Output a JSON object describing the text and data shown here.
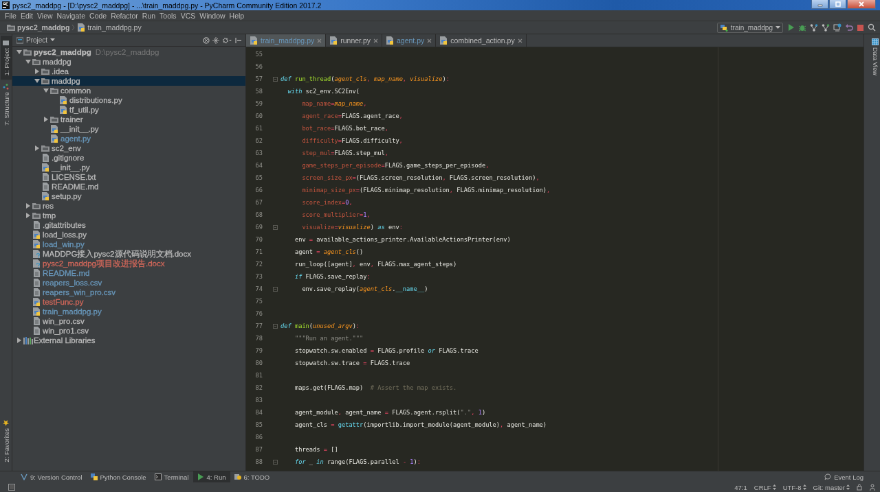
{
  "window": {
    "title": "pysc2_maddpg - [D:\\pysc2_maddpg] - ...\\train_maddpg.py - PyCharm Community Edition 2017.2"
  },
  "menu": [
    "File",
    "Edit",
    "View",
    "Navigate",
    "Code",
    "Refactor",
    "Run",
    "Tools",
    "VCS",
    "Window",
    "Help"
  ],
  "breadcrumbs": [
    {
      "label": "pysc2_maddpg",
      "kind": "folder"
    },
    {
      "label": "train_maddpg.py",
      "kind": "python"
    }
  ],
  "run_config": {
    "label": "train_maddpg"
  },
  "left_tool_tabs": [
    {
      "label": "1: Project",
      "selected": true
    },
    {
      "label": "7: Structure",
      "selected": false
    }
  ],
  "favorites_tab": {
    "label": "2: Favorites"
  },
  "project_panel": {
    "title": "Project",
    "tree": [
      {
        "label": "pysc2_maddpg",
        "hint": "D:\\pysc2_maddpg",
        "kind": "folder",
        "expanded": true,
        "selected": false,
        "color": "#bbbbbb",
        "children": [
          {
            "label": "maddpg",
            "kind": "folder",
            "expanded": true,
            "selected": false,
            "color": "#bbbbbb",
            "children": [
              {
                "label": ".idea",
                "kind": "folder",
                "expanded": false,
                "selected": false,
                "color": "#bbbbbb"
              },
              {
                "label": "maddpg",
                "kind": "folder",
                "expanded": true,
                "selected": true,
                "children": [
                  {
                    "label": "common",
                    "kind": "folder",
                    "expanded": true,
                    "selected": false,
                    "color": "#bbbbbb",
                    "children": [
                      {
                        "label": "distributions.py",
                        "kind": "python",
                        "selected": false,
                        "color": "#bbbbbb"
                      },
                      {
                        "label": "tf_util.py",
                        "kind": "python",
                        "selected": false,
                        "color": "#bbbbbb"
                      }
                    ]
                  },
                  {
                    "label": "trainer",
                    "kind": "folder",
                    "expanded": false,
                    "selected": false,
                    "color": "#bbbbbb"
                  },
                  {
                    "label": "__init__.py",
                    "kind": "python",
                    "selected": false,
                    "color": "#bbbbbb"
                  },
                  {
                    "label": "agent.py",
                    "kind": "python",
                    "selected": false,
                    "color": "#6897bb"
                  }
                ]
              },
              {
                "label": "sc2_env",
                "kind": "folder",
                "expanded": false,
                "selected": false,
                "color": "#bbbbbb"
              },
              {
                "label": ".gitignore",
                "kind": "text",
                "selected": false,
                "color": "#bbbbbb"
              },
              {
                "label": "__init__.py",
                "kind": "python",
                "selected": false,
                "color": "#bbbbbb"
              },
              {
                "label": "LICENSE.txt",
                "kind": "text",
                "selected": false,
                "color": "#bbbbbb"
              },
              {
                "label": "README.md",
                "kind": "text",
                "selected": false,
                "color": "#bbbbbb"
              },
              {
                "label": "setup.py",
                "kind": "python",
                "selected": false,
                "color": "#bbbbbb"
              }
            ]
          },
          {
            "label": "res",
            "kind": "folder",
            "expanded": false,
            "selected": false,
            "color": "#bbbbbb"
          },
          {
            "label": "tmp",
            "kind": "folder",
            "expanded": false,
            "selected": false,
            "color": "#bbbbbb"
          },
          {
            "label": ".gitattributes",
            "kind": "text",
            "selected": false,
            "color": "#bbbbbb"
          },
          {
            "label": "load_loss.py",
            "kind": "python",
            "selected": false,
            "color": "#bbbbbb"
          },
          {
            "label": "load_win.py",
            "kind": "python",
            "selected": false,
            "color": "#6897bb"
          },
          {
            "label": "MADDPG接入pysc2源代码说明文档.docx",
            "kind": "unknown",
            "selected": false,
            "color": "#bbbbbb"
          },
          {
            "label": "pysc2_maddpg项目改进报告.docx",
            "kind": "unknown",
            "selected": false,
            "color": "#d1675a"
          },
          {
            "label": "README.md",
            "kind": "text",
            "selected": false,
            "color": "#6897bb"
          },
          {
            "label": "reapers_loss.csv",
            "kind": "text",
            "selected": false,
            "color": "#6897bb"
          },
          {
            "label": "reapers_win_pro.csv",
            "kind": "text",
            "selected": false,
            "color": "#6897bb"
          },
          {
            "label": "testFunc.py",
            "kind": "python",
            "selected": false,
            "color": "#d1675a"
          },
          {
            "label": "train_maddpg.py",
            "kind": "python",
            "selected": false,
            "color": "#6897bb"
          },
          {
            "label": "win_pro.csv",
            "kind": "text",
            "selected": false,
            "color": "#bbbbbb"
          },
          {
            "label": "win_pro1.csv",
            "kind": "text",
            "selected": false,
            "color": "#bbbbbb"
          }
        ]
      },
      {
        "label": "External Libraries",
        "kind": "library",
        "expanded": false,
        "selected": false,
        "color": "#bbbbbb"
      }
    ]
  },
  "editor": {
    "tabs": [
      {
        "label": "train_maddpg.py",
        "selected": true,
        "color": "#6897bb"
      },
      {
        "label": "runner.py",
        "selected": false,
        "color": "#bbbbbb"
      },
      {
        "label": "agent.py",
        "selected": false,
        "color": "#6897bb"
      },
      {
        "label": "combined_action.py",
        "selected": false,
        "color": "#bbbbbb"
      }
    ],
    "lines": [
      {
        "number": "55"
      },
      {
        "number": "56"
      },
      {
        "number": "57",
        "fold": true,
        "tokens": [
          {
            "kind": "keyword",
            "text": "def "
          },
          {
            "kind": "function",
            "text": "run_thread"
          },
          {
            "kind": "plain",
            "text": "("
          },
          {
            "kind": "param",
            "text": "agent_cls"
          },
          {
            "kind": "operator",
            "text": ", "
          },
          {
            "kind": "param",
            "text": "map_name"
          },
          {
            "kind": "operator",
            "text": ", "
          },
          {
            "kind": "param",
            "text": "visualize"
          },
          {
            "kind": "plain",
            "text": ")"
          },
          {
            "kind": "operator",
            "text": ":"
          }
        ]
      },
      {
        "number": "58",
        "tokens": [
          {
            "kind": "keyword",
            "text": "  with"
          },
          {
            "kind": "plain",
            "text": " sc2_env.SC2Env("
          }
        ]
      },
      {
        "number": "59",
        "tokens": [
          {
            "kind": "kwarg",
            "text": "      map_name"
          },
          {
            "kind": "operator",
            "text": "="
          },
          {
            "kind": "param",
            "text": "map_name"
          },
          {
            "kind": "operator",
            "text": ","
          }
        ]
      },
      {
        "number": "60",
        "tokens": [
          {
            "kind": "kwarg",
            "text": "      agent_race"
          },
          {
            "kind": "operator",
            "text": "="
          },
          {
            "kind": "plain",
            "text": "FLAGS.agent_race"
          },
          {
            "kind": "operator",
            "text": ","
          }
        ]
      },
      {
        "number": "61",
        "tokens": [
          {
            "kind": "kwarg",
            "text": "      bot_race"
          },
          {
            "kind": "operator",
            "text": "="
          },
          {
            "kind": "plain",
            "text": "FLAGS.bot_race"
          },
          {
            "kind": "operator",
            "text": ","
          }
        ]
      },
      {
        "number": "62",
        "tokens": [
          {
            "kind": "kwarg",
            "text": "      difficulty"
          },
          {
            "kind": "operator",
            "text": "="
          },
          {
            "kind": "plain",
            "text": "FLAGS.difficulty"
          },
          {
            "kind": "operator",
            "text": ","
          }
        ]
      },
      {
        "number": "63",
        "tokens": [
          {
            "kind": "kwarg",
            "text": "      step_mul"
          },
          {
            "kind": "operator",
            "text": "="
          },
          {
            "kind": "plain",
            "text": "FLAGS.step_mul"
          },
          {
            "kind": "operator",
            "text": ","
          }
        ]
      },
      {
        "number": "64",
        "tokens": [
          {
            "kind": "kwarg",
            "text": "      game_steps_per_episode"
          },
          {
            "kind": "operator",
            "text": "="
          },
          {
            "kind": "plain",
            "text": "FLAGS.game_steps_per_episode"
          },
          {
            "kind": "operator",
            "text": ","
          }
        ]
      },
      {
        "number": "65",
        "tokens": [
          {
            "kind": "kwarg",
            "text": "      screen_size_px"
          },
          {
            "kind": "operator",
            "text": "="
          },
          {
            "kind": "plain",
            "text": "(FLAGS.screen_resolution"
          },
          {
            "kind": "operator",
            "text": ", "
          },
          {
            "kind": "plain",
            "text": "FLAGS.screen_resolution)"
          },
          {
            "kind": "operator",
            "text": ","
          }
        ]
      },
      {
        "number": "66",
        "tokens": [
          {
            "kind": "kwarg",
            "text": "      minimap_size_px"
          },
          {
            "kind": "operator",
            "text": "="
          },
          {
            "kind": "plain",
            "text": "(FLAGS.minimap_resolution"
          },
          {
            "kind": "operator",
            "text": ", "
          },
          {
            "kind": "plain",
            "text": "FLAGS.minimap_resolution)"
          },
          {
            "kind": "operator",
            "text": ","
          }
        ]
      },
      {
        "number": "67",
        "tokens": [
          {
            "kind": "kwarg",
            "text": "      score_index"
          },
          {
            "kind": "operator",
            "text": "="
          },
          {
            "kind": "number",
            "text": "0"
          },
          {
            "kind": "operator",
            "text": ","
          }
        ]
      },
      {
        "number": "68",
        "tokens": [
          {
            "kind": "kwarg",
            "text": "      score_multiplier"
          },
          {
            "kind": "operator",
            "text": "="
          },
          {
            "kind": "number",
            "text": "1"
          },
          {
            "kind": "operator",
            "text": ","
          }
        ]
      },
      {
        "number": "69",
        "fold": true,
        "tokens": [
          {
            "kind": "kwarg",
            "text": "      visualize"
          },
          {
            "kind": "operator",
            "text": "="
          },
          {
            "kind": "param",
            "text": "visualize"
          },
          {
            "kind": "plain",
            "text": ") "
          },
          {
            "kind": "keyword",
            "text": "as"
          },
          {
            "kind": "plain",
            "text": " env"
          },
          {
            "kind": "operator",
            "text": ":"
          }
        ]
      },
      {
        "number": "70",
        "tokens": [
          {
            "kind": "plain",
            "text": "    env "
          },
          {
            "kind": "operator",
            "text": "="
          },
          {
            "kind": "plain",
            "text": " available_actions_printer.AvailableActionsPrinter(env)"
          }
        ]
      },
      {
        "number": "71",
        "tokens": [
          {
            "kind": "plain",
            "text": "    agent "
          },
          {
            "kind": "operator",
            "text": "="
          },
          {
            "kind": "param",
            "text": " agent_cls"
          },
          {
            "kind": "plain",
            "text": "()"
          }
        ]
      },
      {
        "number": "72",
        "tokens": [
          {
            "kind": "plain",
            "text": "    run_loop([agent]"
          },
          {
            "kind": "operator",
            "text": ", "
          },
          {
            "kind": "plain",
            "text": "env"
          },
          {
            "kind": "operator",
            "text": ", "
          },
          {
            "kind": "plain",
            "text": "FLAGS.max_agent_steps)"
          }
        ]
      },
      {
        "number": "73",
        "tokens": [
          {
            "kind": "keyword",
            "text": "    if"
          },
          {
            "kind": "plain",
            "text": " FLAGS.save_replay"
          },
          {
            "kind": "operator",
            "text": ":"
          }
        ]
      },
      {
        "number": "74",
        "fold": true,
        "tokens": [
          {
            "kind": "plain",
            "text": "      env.save_replay("
          },
          {
            "kind": "param",
            "text": "agent_cls"
          },
          {
            "kind": "plain",
            "text": "."
          },
          {
            "kind": "builtin",
            "text": "__name__"
          },
          {
            "kind": "plain",
            "text": ")"
          }
        ]
      },
      {
        "number": "75"
      },
      {
        "number": "76"
      },
      {
        "number": "77",
        "fold": true,
        "tokens": [
          {
            "kind": "keyword",
            "text": "def "
          },
          {
            "kind": "function",
            "text": "main"
          },
          {
            "kind": "plain",
            "text": "("
          },
          {
            "kind": "param",
            "text": "unused_argv"
          },
          {
            "kind": "plain",
            "text": ")"
          },
          {
            "kind": "operator",
            "text": ":"
          }
        ]
      },
      {
        "number": "78",
        "tokens": [
          {
            "kind": "string",
            "text": "    \"\"\"Run an agent.\"\"\""
          }
        ]
      },
      {
        "number": "79",
        "tokens": [
          {
            "kind": "plain",
            "text": "    stopwatch.sw.enabled "
          },
          {
            "kind": "operator",
            "text": "="
          },
          {
            "kind": "plain",
            "text": " FLAGS.profile "
          },
          {
            "kind": "keyword",
            "text": "or"
          },
          {
            "kind": "plain",
            "text": " FLAGS.trace"
          }
        ]
      },
      {
        "number": "80",
        "tokens": [
          {
            "kind": "plain",
            "text": "    stopwatch.sw.trace "
          },
          {
            "kind": "operator",
            "text": "="
          },
          {
            "kind": "plain",
            "text": " FLAGS.trace"
          }
        ]
      },
      {
        "number": "81"
      },
      {
        "number": "82",
        "tokens": [
          {
            "kind": "plain",
            "text": "    maps.get(FLAGS.map)  "
          },
          {
            "kind": "comment",
            "text": "# Assert the map exists."
          }
        ]
      },
      {
        "number": "83"
      },
      {
        "number": "84",
        "tokens": [
          {
            "kind": "plain",
            "text": "    agent_module"
          },
          {
            "kind": "operator",
            "text": ", "
          },
          {
            "kind": "plain",
            "text": "agent_name "
          },
          {
            "kind": "operator",
            "text": "="
          },
          {
            "kind": "plain",
            "text": " FLAGS.agent.rsplit("
          },
          {
            "kind": "string",
            "text": "\".\""
          },
          {
            "kind": "operator",
            "text": ", "
          },
          {
            "kind": "number",
            "text": "1"
          },
          {
            "kind": "plain",
            "text": ")"
          }
        ]
      },
      {
        "number": "85",
        "tokens": [
          {
            "kind": "plain",
            "text": "    agent_cls "
          },
          {
            "kind": "operator",
            "text": "="
          },
          {
            "kind": "builtin",
            "text": " getattr"
          },
          {
            "kind": "plain",
            "text": "(importlib.import_module(agent_module)"
          },
          {
            "kind": "operator",
            "text": ", "
          },
          {
            "kind": "plain",
            "text": "agent_name)"
          }
        ]
      },
      {
        "number": "86"
      },
      {
        "number": "87",
        "tokens": [
          {
            "kind": "plain",
            "text": "    threads "
          },
          {
            "kind": "operator",
            "text": "="
          },
          {
            "kind": "plain",
            "text": " []"
          }
        ]
      },
      {
        "number": "88",
        "fold": true,
        "tokens": [
          {
            "kind": "keyword",
            "text": "    for"
          },
          {
            "kind": "plain",
            "text": " _ "
          },
          {
            "kind": "keyword",
            "text": "in"
          },
          {
            "kind": "plain",
            "text": " range(FLAGS.parallel "
          },
          {
            "kind": "operator",
            "text": "-"
          },
          {
            "kind": "number",
            "text": " 1"
          },
          {
            "kind": "plain",
            "text": ")"
          },
          {
            "kind": "operator",
            "text": ":"
          }
        ]
      }
    ]
  },
  "right_tool_tabs": [
    {
      "label": "Data View"
    }
  ],
  "bottom_tools": [
    {
      "label": "9: Version Control",
      "kind": "vcs",
      "selected": false
    },
    {
      "label": "Python Console",
      "kind": "python",
      "selected": false
    },
    {
      "label": "Terminal",
      "kind": "terminal",
      "selected": false
    },
    {
      "label": "4: Run",
      "kind": "run",
      "selected": true
    },
    {
      "label": "6: TODO",
      "kind": "todo",
      "selected": false
    }
  ],
  "event_log": {
    "label": "Event Log"
  },
  "status_bar": {
    "position": "47:1",
    "line_separator": "CRLF",
    "encoding": "UTF-8",
    "branch": "Git: master"
  }
}
